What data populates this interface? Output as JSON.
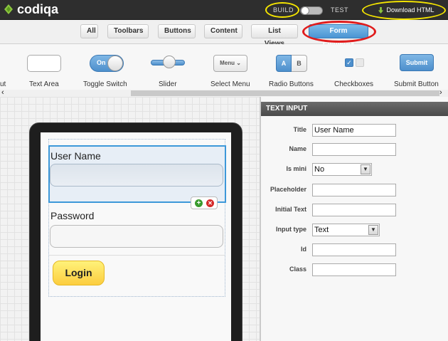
{
  "app": {
    "name": "codiqa"
  },
  "topbar": {
    "build_label": "BUILD",
    "test_label": "TEST",
    "download_label": "Download HTML"
  },
  "categories": [
    {
      "label": "All",
      "active": false
    },
    {
      "label": "Toolbars",
      "active": false
    },
    {
      "label": "Buttons",
      "active": false
    },
    {
      "label": "Content",
      "active": false
    },
    {
      "label": "List Views",
      "active": false
    },
    {
      "label": "Form Elements",
      "active": true
    }
  ],
  "palette": {
    "cut_label": "ut",
    "widgets": [
      {
        "label": "Text Area"
      },
      {
        "label": "Toggle Switch",
        "inner": "On"
      },
      {
        "label": "Slider"
      },
      {
        "label": "Select Menu",
        "inner": "Menu ⌄"
      },
      {
        "label": "Radio Buttons",
        "options": [
          "A",
          "B"
        ]
      },
      {
        "label": "Checkboxes"
      },
      {
        "label": "Submit Button",
        "inner": "Submit"
      }
    ]
  },
  "preview": {
    "username_label": "User Name",
    "password_label": "Password",
    "login_label": "Login"
  },
  "properties": {
    "header": "TEXT INPUT",
    "fields": [
      {
        "label": "Title",
        "type": "text",
        "value": "User Name"
      },
      {
        "label": "Name",
        "type": "text",
        "value": ""
      },
      {
        "label": "Is mini",
        "type": "select",
        "value": "No"
      },
      {
        "label": "Placeholder",
        "type": "text",
        "value": ""
      },
      {
        "label": "Initial Text",
        "type": "text",
        "value": ""
      },
      {
        "label": "Input type",
        "type": "select",
        "value": "Text"
      },
      {
        "label": "Id",
        "type": "text",
        "value": ""
      },
      {
        "label": "Class",
        "type": "text",
        "value": ""
      }
    ]
  },
  "colors": {
    "accent": "#4a95d3",
    "login_button": "#fccd3f",
    "highlight_yellow": "#f5e500",
    "highlight_red": "#e01c1c",
    "topbar": "#2e2e2e"
  }
}
